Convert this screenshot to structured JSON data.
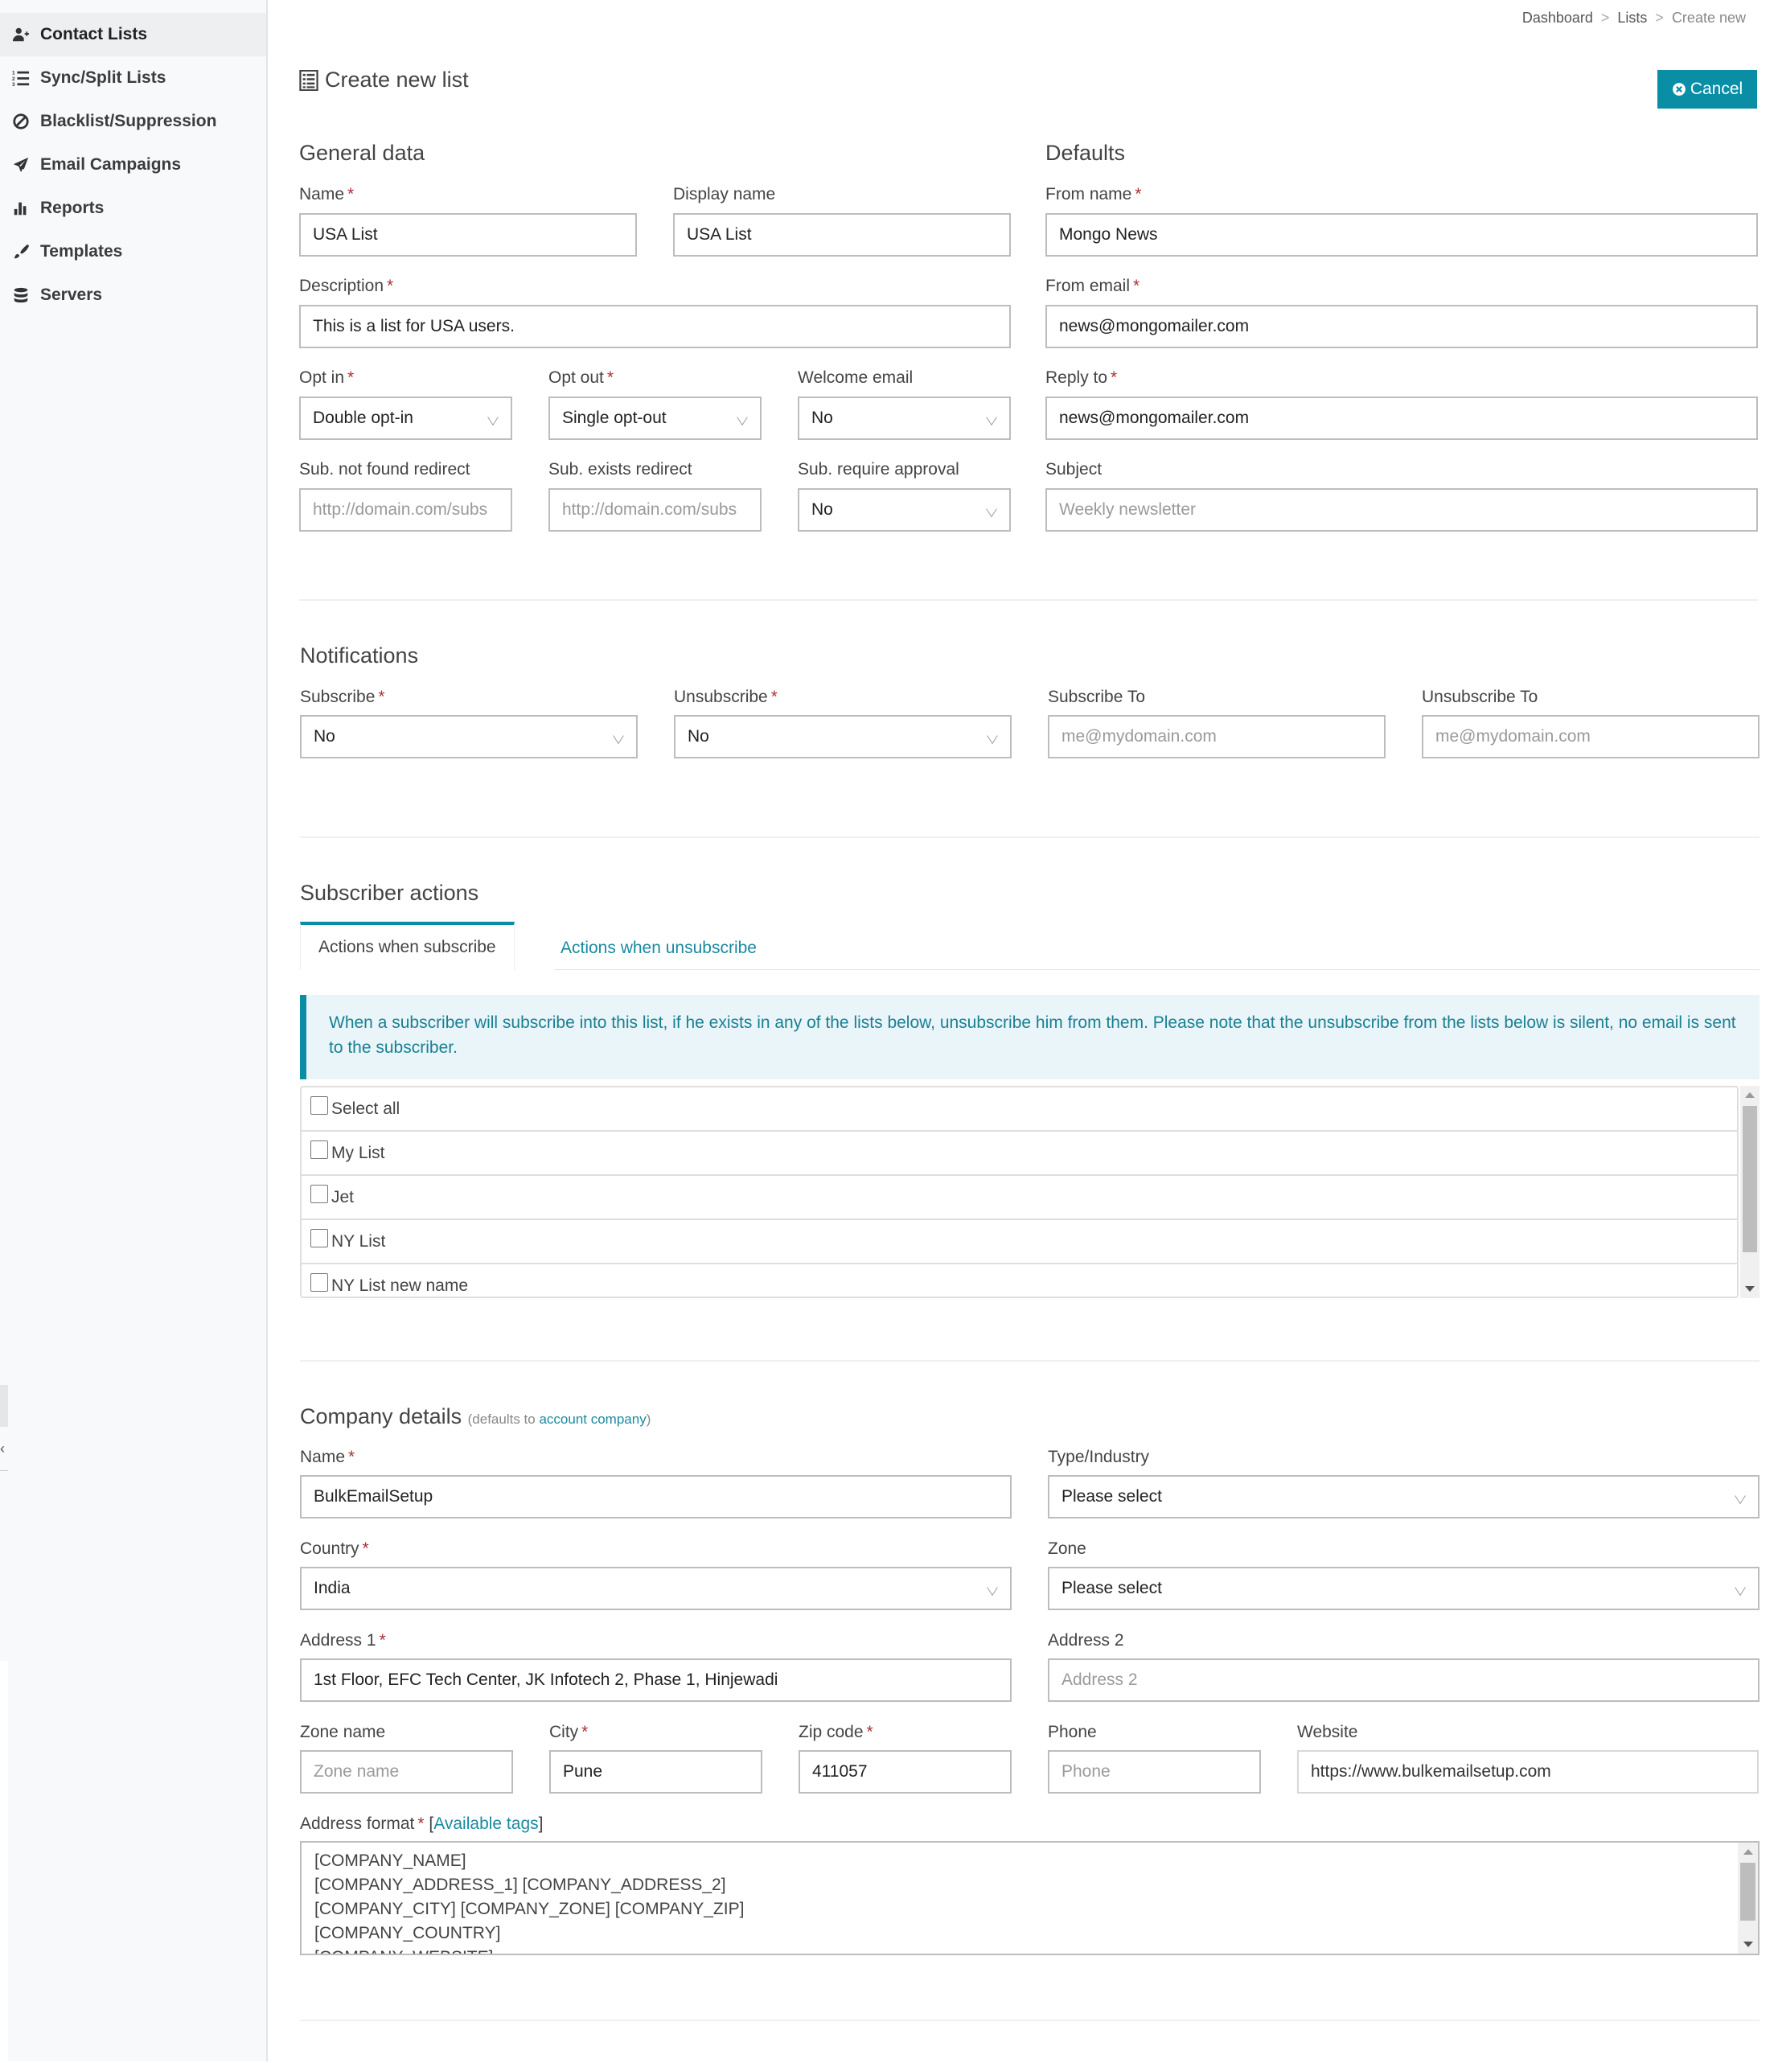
{
  "sidebar": {
    "items": [
      {
        "label": "Contact Lists",
        "icon": "user-plus-icon",
        "active": true
      },
      {
        "label": "Sync/Split Lists",
        "icon": "numbered-list-icon",
        "active": false
      },
      {
        "label": "Blacklist/Suppression",
        "icon": "ban-icon",
        "active": false
      },
      {
        "label": "Email Campaigns",
        "icon": "paper-plane-icon",
        "active": false
      },
      {
        "label": "Reports",
        "icon": "bar-chart-icon",
        "active": false
      },
      {
        "label": "Templates",
        "icon": "paint-brush-icon",
        "active": false
      },
      {
        "label": "Servers",
        "icon": "database-icon",
        "active": false
      }
    ]
  },
  "breadcrumb": {
    "items": [
      "Dashboard",
      "Lists"
    ],
    "current": "Create new",
    "separator": ">"
  },
  "header": {
    "title": "Create new list",
    "cancel_label": "Cancel",
    "accent": "#0a8ea6"
  },
  "general": {
    "title": "General data",
    "name": {
      "label": "Name",
      "value": "USA List"
    },
    "display_name": {
      "label": "Display name",
      "value": "USA List"
    },
    "description": {
      "label": "Description",
      "value": "This is a list for USA users."
    },
    "opt_in": {
      "label": "Opt in",
      "value": "Double opt-in"
    },
    "opt_out": {
      "label": "Opt out",
      "value": "Single opt-out"
    },
    "welcome_email": {
      "label": "Welcome email",
      "value": "No"
    },
    "sub_not_found": {
      "label": "Sub. not found redirect",
      "placeholder": "http://domain.com/subs"
    },
    "sub_exists": {
      "label": "Sub. exists redirect",
      "placeholder": "http://domain.com/subs"
    },
    "sub_approval": {
      "label": "Sub. require approval",
      "value": "No"
    }
  },
  "defaults": {
    "title": "Defaults",
    "from_name": {
      "label": "From name",
      "value": "Mongo News"
    },
    "from_email": {
      "label": "From email",
      "value": "news@mongomailer.com"
    },
    "reply_to": {
      "label": "Reply to",
      "value": "news@mongomailer.com"
    },
    "subject": {
      "label": "Subject",
      "placeholder": "Weekly newsletter"
    }
  },
  "notifications": {
    "title": "Notifications",
    "subscribe": {
      "label": "Subscribe",
      "value": "No"
    },
    "unsubscribe": {
      "label": "Unsubscribe",
      "value": "No"
    },
    "subscribe_to": {
      "label": "Subscribe To",
      "placeholder": "me@mydomain.com"
    },
    "unsubscribe_to": {
      "label": "Unsubscribe To",
      "placeholder": "me@mydomain.com"
    }
  },
  "subscriber_actions": {
    "title": "Subscriber actions",
    "tabs": [
      {
        "label": "Actions when subscribe",
        "active": true
      },
      {
        "label": "Actions when unsubscribe",
        "active": false
      }
    ],
    "info": "When a subscriber will subscribe into this list, if he exists in any of the lists below, unsubscribe him from them. Please note that the unsubscribe from the lists below is silent, no email is sent to the subscriber.",
    "lists": [
      {
        "label": "Select all",
        "checked": false
      },
      {
        "label": "My List",
        "checked": false
      },
      {
        "label": "Jet",
        "checked": false
      },
      {
        "label": "NY List",
        "checked": false
      },
      {
        "label": "NY List new name",
        "checked": false
      }
    ]
  },
  "company": {
    "title": "Company details",
    "note_prefix": "(defaults to ",
    "note_link": "account company",
    "note_suffix": ")",
    "name": {
      "label": "Name",
      "value": "BulkEmailSetup"
    },
    "type_industry": {
      "label": "Type/Industry",
      "value": "Please select"
    },
    "country": {
      "label": "Country",
      "value": "India"
    },
    "zone": {
      "label": "Zone",
      "value": "Please select"
    },
    "address1": {
      "label": "Address 1",
      "value": "1st Floor, EFC Tech Center, JK Infotech 2, Phase 1, Hinjewadi"
    },
    "address2": {
      "label": "Address 2",
      "placeholder": "Address 2"
    },
    "zone_name": {
      "label": "Zone name",
      "placeholder": "Zone name"
    },
    "city": {
      "label": "City",
      "value": "Pune"
    },
    "zip": {
      "label": "Zip code",
      "value": "411057"
    },
    "phone": {
      "label": "Phone",
      "placeholder": "Phone"
    },
    "website": {
      "label": "Website",
      "value": "https://www.bulkemailsetup.com"
    },
    "address_format": {
      "label": "Address format",
      "tags_link": "Available tags",
      "lines": [
        "[COMPANY_NAME]",
        "[COMPANY_ADDRESS_1] [COMPANY_ADDRESS_2]",
        "[COMPANY_CITY] [COMPANY_ZONE] [COMPANY_ZIP]",
        "[COMPANY_COUNTRY]",
        "[COMPANY_WEBSITE]"
      ]
    }
  },
  "required_marker": "*"
}
